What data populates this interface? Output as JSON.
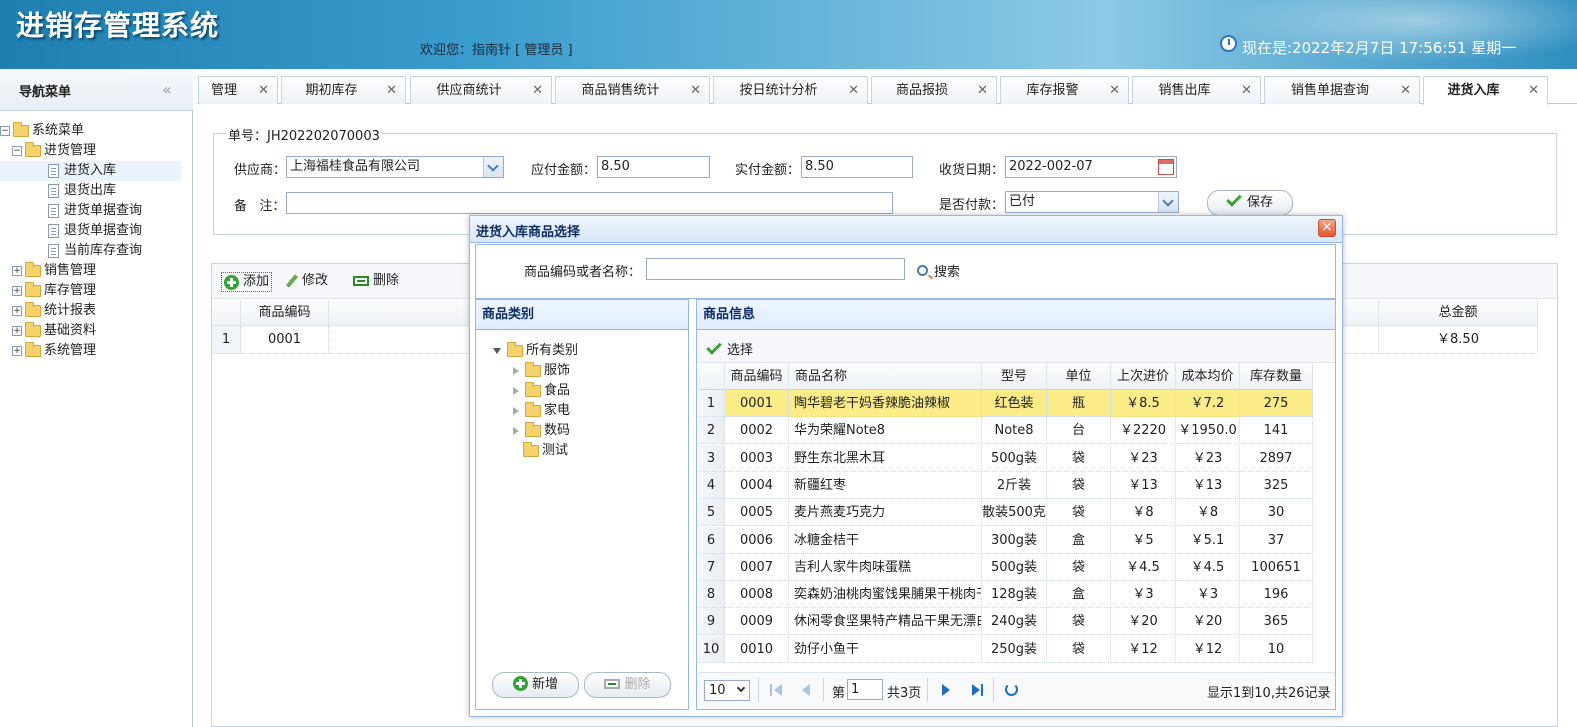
{
  "header": {
    "app_title": "进销存管理系统",
    "welcome": "欢迎您：指南针 [ 管理员 ]",
    "datetime": "现在是:2022年2月7日 17:56:51 星期一"
  },
  "nav": {
    "title": "导航菜单",
    "collapse_glyph": "«",
    "root": "系统菜单",
    "groups": [
      {
        "label": "进货管理",
        "expanded": true,
        "items": [
          "进货入库",
          "退货出库",
          "进货单据查询",
          "退货单据查询",
          "当前库存查询"
        ]
      },
      {
        "label": "销售管理"
      },
      {
        "label": "库存管理"
      },
      {
        "label": "统计报表"
      },
      {
        "label": "基础资料"
      },
      {
        "label": "系统管理"
      }
    ]
  },
  "tabs": [
    {
      "label": "管理"
    },
    {
      "label": "期初库存"
    },
    {
      "label": "供应商统计"
    },
    {
      "label": "商品销售统计"
    },
    {
      "label": "按日统计分析"
    },
    {
      "label": "商品报损"
    },
    {
      "label": "库存报警"
    },
    {
      "label": "销售出库"
    },
    {
      "label": "销售单据查询"
    },
    {
      "label": "进货入库",
      "active": true
    }
  ],
  "form": {
    "order_no": "单号：JH202202070003",
    "supplier_label": "供应商：",
    "supplier_value": "上海福桂食品有限公司",
    "payable_label": "应付金额：",
    "payable_value": "8.50",
    "paid_label": "实付金额：",
    "paid_value": "8.50",
    "date_label": "收货日期：",
    "date_value": "2022-002-07",
    "remark_label": "备   注：",
    "remark_value": "",
    "paystatus_label": "是否付款：",
    "paystatus_value": "已付",
    "save_label": "保存"
  },
  "toolbar": {
    "add": "添加",
    "edit": "修改",
    "delete": "删除"
  },
  "grid": {
    "headers": {
      "code": "商品编码",
      "total": "总金额"
    },
    "rows": [
      {
        "num": "1",
        "code": "0001",
        "total": "￥8.50"
      }
    ]
  },
  "dialog": {
    "title": "进货入库商品选择",
    "close_glyph": "×",
    "search_label": "商品编码或者名称：",
    "search_value": "",
    "search_button": "搜索",
    "category_panel_title": "商品类别",
    "categories_root": "所有类别",
    "categories": [
      "服饰",
      "食品",
      "家电",
      "数码",
      "测试"
    ],
    "add_category": "新增",
    "delete_category": "删除",
    "product_panel_title": "商品信息",
    "select_button": "选择",
    "columns": [
      "商品编码",
      "商品名称",
      "型号",
      "单位",
      "上次进价",
      "成本均价",
      "库存数量"
    ],
    "products": [
      {
        "num": "1",
        "code": "0001",
        "name": "陶华碧老干妈香辣脆油辣椒",
        "model": "红色装",
        "unit": "瓶",
        "last_price": "￥8.5",
        "avg_cost": "￥7.2",
        "stock": "275"
      },
      {
        "num": "2",
        "code": "0002",
        "name": "华为荣耀Note8",
        "model": "Note8",
        "unit": "台",
        "last_price": "￥2220",
        "avg_cost": "￥1950.0",
        "stock": "141"
      },
      {
        "num": "3",
        "code": "0003",
        "name": "野生东北黑木耳",
        "model": "500g装",
        "unit": "袋",
        "last_price": "￥23",
        "avg_cost": "￥23",
        "stock": "2897"
      },
      {
        "num": "4",
        "code": "0004",
        "name": "新疆红枣",
        "model": "2斤装",
        "unit": "袋",
        "last_price": "￥13",
        "avg_cost": "￥13",
        "stock": "325"
      },
      {
        "num": "5",
        "code": "0005",
        "name": "麦片燕麦巧克力",
        "model": "散装500克",
        "unit": "袋",
        "last_price": "￥8",
        "avg_cost": "￥8",
        "stock": "30"
      },
      {
        "num": "6",
        "code": "0006",
        "name": "冰糖金桔干",
        "model": "300g装",
        "unit": "盒",
        "last_price": "￥5",
        "avg_cost": "￥5.1",
        "stock": "37"
      },
      {
        "num": "7",
        "code": "0007",
        "name": "吉利人家牛肉味蛋糕",
        "model": "500g装",
        "unit": "袋",
        "last_price": "￥4.5",
        "avg_cost": "￥4.5",
        "stock": "100651"
      },
      {
        "num": "8",
        "code": "0008",
        "name": "奕森奶油桃肉蜜饯果脯果干桃肉干",
        "model": "128g装",
        "unit": "盒",
        "last_price": "￥3",
        "avg_cost": "￥3",
        "stock": "196"
      },
      {
        "num": "9",
        "code": "0009",
        "name": "休闲零食坚果特产精品干果无漂白",
        "model": "240g装",
        "unit": "袋",
        "last_price": "￥20",
        "avg_cost": "￥20",
        "stock": "365"
      },
      {
        "num": "10",
        "code": "0010",
        "name": "劲仔小鱼干",
        "model": "250g装",
        "unit": "袋",
        "last_price": "￥12",
        "avg_cost": "￥12",
        "stock": "10"
      }
    ],
    "pager": {
      "page_size": "10",
      "page_prefix": "第",
      "page_value": "1",
      "page_total": "共3页",
      "summary": "显示1到10,共26记录"
    }
  },
  "colors": {
    "accent": "#95b8e7",
    "highlight_row": "#fbec88",
    "header_blue": "#2f8fc0"
  }
}
